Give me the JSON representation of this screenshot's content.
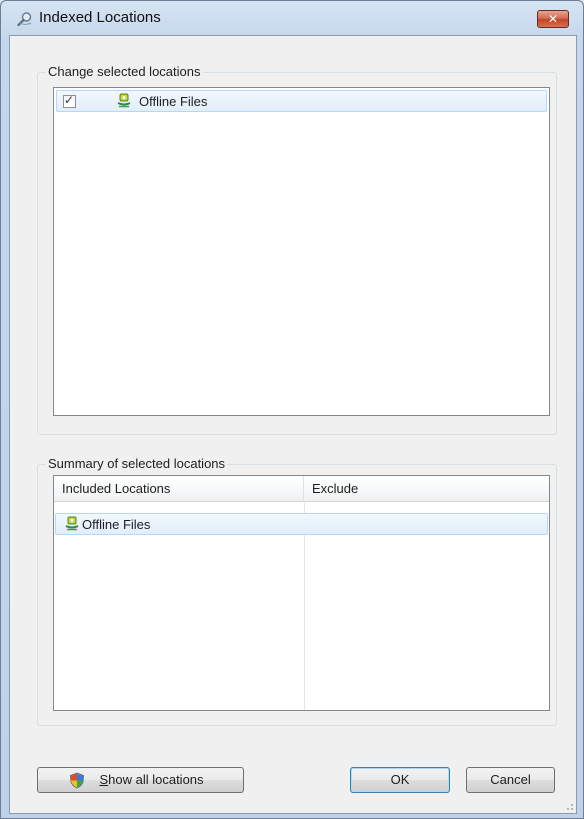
{
  "window": {
    "title": "Indexed Locations",
    "close_label": "✕"
  },
  "change_group": {
    "label": "Change selected locations",
    "items": [
      {
        "label": "Offline Files",
        "checked": true
      }
    ]
  },
  "summary_group": {
    "label": "Summary of selected locations",
    "columns": [
      "Included Locations",
      "Exclude"
    ],
    "rows": [
      {
        "included": "Offline Files",
        "exclude": ""
      }
    ]
  },
  "buttons": {
    "show_all": "Show all locations",
    "show_all_mnemonic": "S",
    "show_all_rest": "how all locations",
    "ok": "OK",
    "cancel": "Cancel"
  },
  "icons": {
    "title": "search-magnifier-icon",
    "location": "offline-files-icon",
    "shield": "uac-shield-icon"
  },
  "colors": {
    "selection": "#e1eefb",
    "selection_border": "#b8d6fb",
    "close": "#c24428"
  }
}
